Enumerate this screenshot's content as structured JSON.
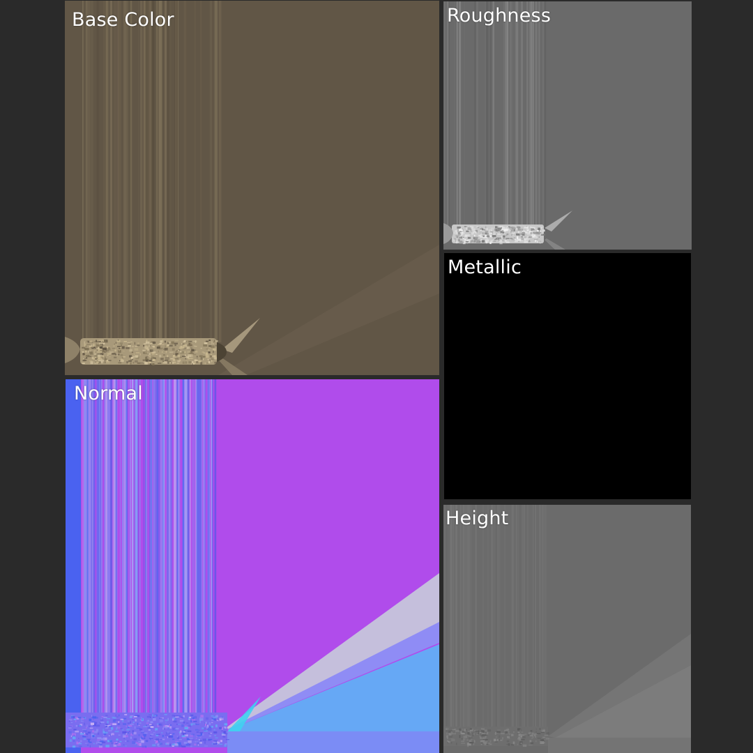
{
  "maps": {
    "base_color": {
      "label": "Base Color",
      "fill": "#615646",
      "stripe": "#8a7c60",
      "accent": "#c7b68f"
    },
    "normal": {
      "label": "Normal",
      "fill": "#b04ceb",
      "stripe": "#8f8cf5",
      "accent": "#66a8f5"
    },
    "roughness": {
      "label": "Roughness",
      "fill": "#6a6a6a",
      "stripe": "#8a8a8a",
      "accent": "#d0d0d0"
    },
    "metallic": {
      "label": "Metallic",
      "fill": "#000000"
    },
    "height": {
      "label": "Height",
      "fill": "#6b6b6b",
      "stripe": "#7e7e7e",
      "accent": "#8c8c8c"
    }
  }
}
